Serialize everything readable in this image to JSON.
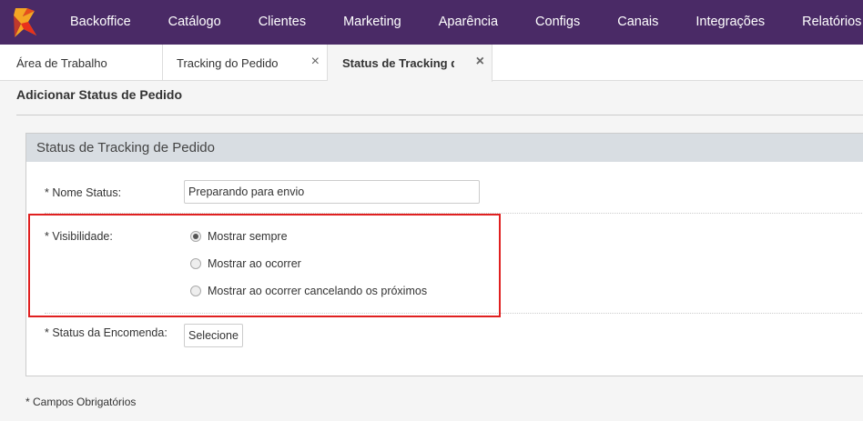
{
  "topnav": {
    "brand_color": "#4a2a66",
    "logo_icon": "x-logo-icon",
    "items": [
      {
        "label": "Backoffice"
      },
      {
        "label": "Catálogo"
      },
      {
        "label": "Clientes"
      },
      {
        "label": "Marketing"
      },
      {
        "label": "Aparência"
      },
      {
        "label": "Configs"
      },
      {
        "label": "Canais"
      },
      {
        "label": "Integrações"
      },
      {
        "label": "Relatórios"
      }
    ]
  },
  "tabs": [
    {
      "label": "Área de Trabalho",
      "closable": false,
      "active": false
    },
    {
      "label": "Tracking do Pedido",
      "closable": true,
      "active": false
    },
    {
      "label": "Status de Tracking do Pe",
      "closable": true,
      "active": true
    }
  ],
  "page": {
    "title": "Adicionar Status de Pedido"
  },
  "panel": {
    "header": "Status de Tracking de Pedido",
    "nome_status": {
      "label": "* Nome Status:",
      "value": "Preparando para envio"
    },
    "visibilidade": {
      "label": "* Visibilidade:",
      "options": [
        {
          "label": "Mostrar sempre",
          "checked": true
        },
        {
          "label": "Mostrar ao ocorrer",
          "checked": false
        },
        {
          "label": "Mostrar ao ocorrer cancelando os próximos",
          "checked": false
        }
      ]
    },
    "status_encomenda": {
      "label": "* Status da Encomenda:",
      "button": "Selecione"
    }
  },
  "footnote": "* Campos Obrigatórios",
  "close_glyph": "×"
}
